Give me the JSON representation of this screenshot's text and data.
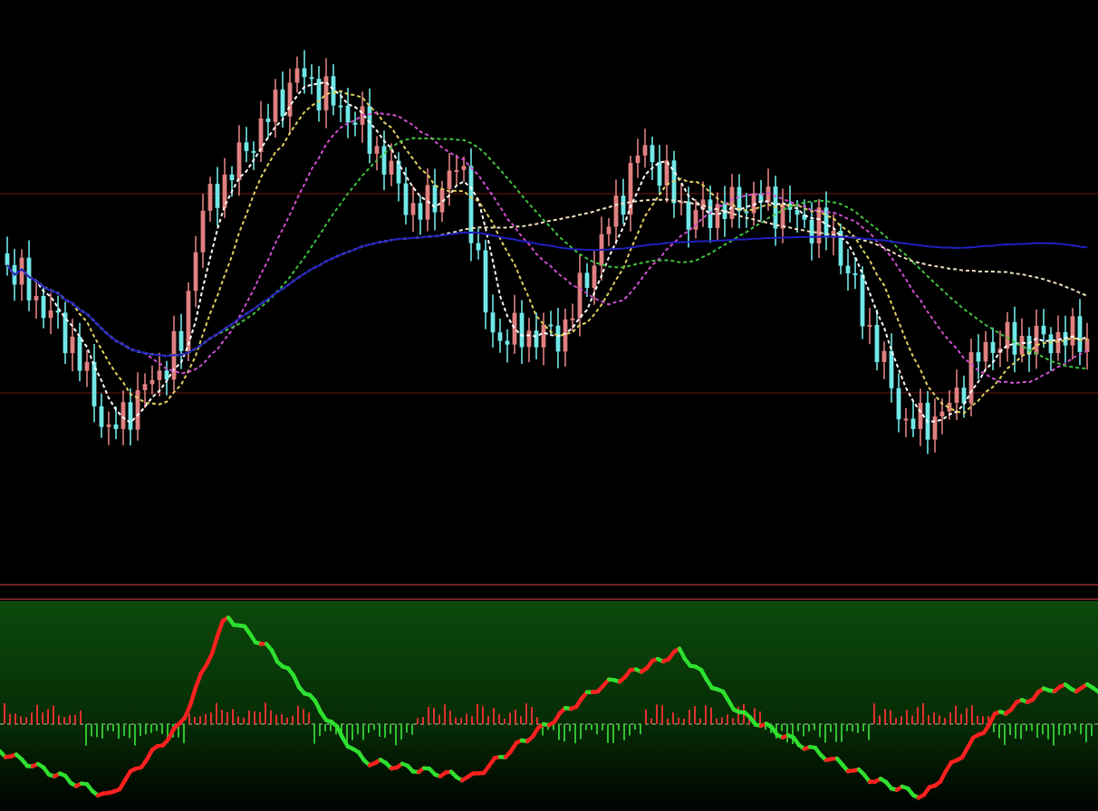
{
  "price_panel": {
    "kind": "candlestick"
  },
  "indicator_panel": {
    "kind": "oscillator"
  }
}
